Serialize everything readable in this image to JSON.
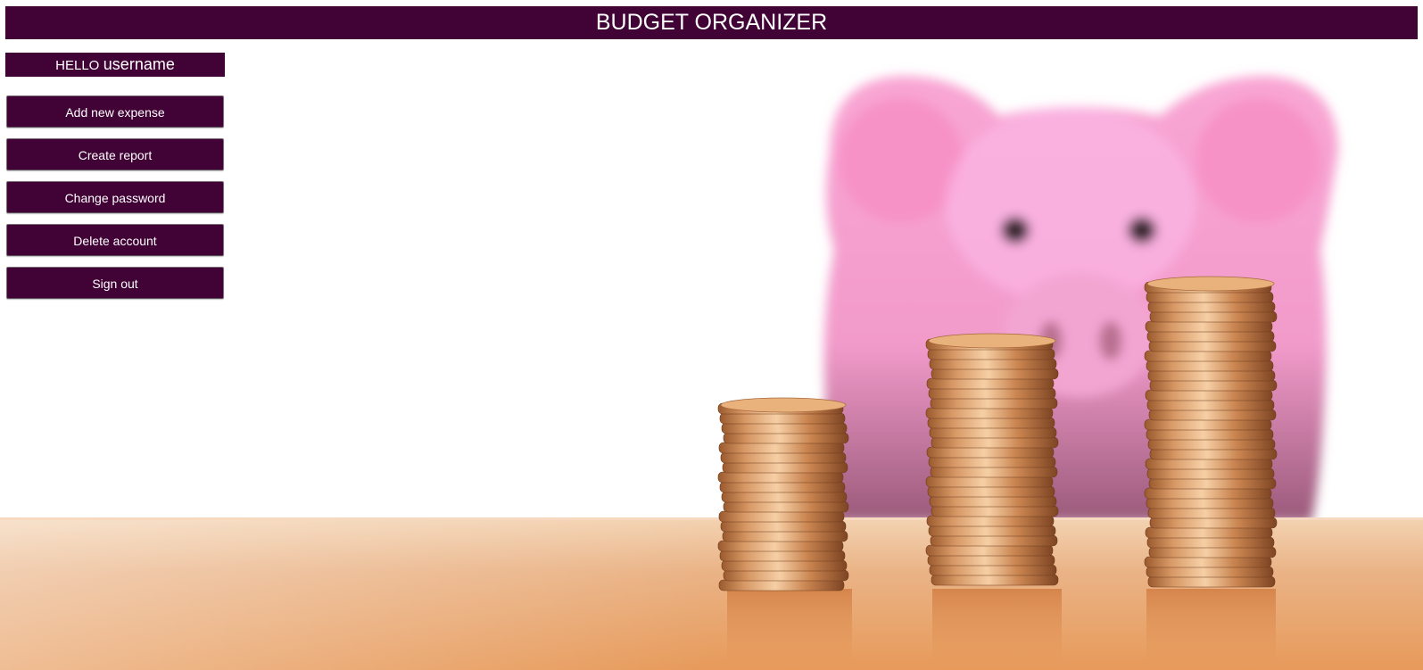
{
  "header": {
    "title": "BUDGET ORGANIZER"
  },
  "greeting": {
    "hello": "HELLO",
    "username": "username"
  },
  "menu": [
    {
      "label": "Add new expense"
    },
    {
      "label": "Create report"
    },
    {
      "label": "Change password"
    },
    {
      "label": "Delete account"
    },
    {
      "label": "Sign out"
    }
  ],
  "colors": {
    "brand": "#410236",
    "text": "#ffffff"
  },
  "background_image": "piggy-bank-with-coin-stacks"
}
